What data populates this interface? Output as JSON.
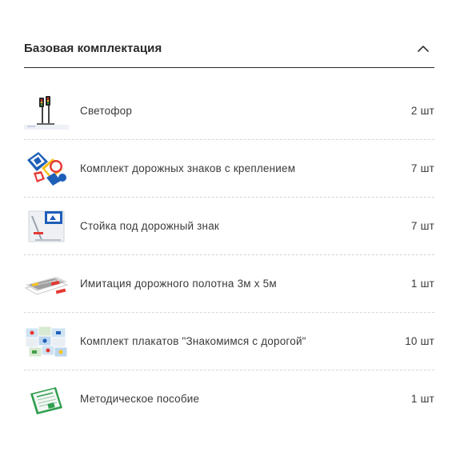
{
  "section": {
    "title": "Базовая комплектация",
    "expanded": true,
    "toggle_icon": "chevron-up-icon"
  },
  "items": [
    {
      "label": "Светофор",
      "qty": "2 шт",
      "icon": "traffic-light-image"
    },
    {
      "label": "Комплект дорожных знаков с креплением",
      "qty": "7 шт",
      "icon": "road-signs-image"
    },
    {
      "label": "Стойка под дорожный знак",
      "qty": "7 шт",
      "icon": "sign-stand-image"
    },
    {
      "label": "Имитация дорожного полотна 3м х 5м",
      "qty": "1 шт",
      "icon": "road-mat-image"
    },
    {
      "label": "Комплект плакатов \"Знакомимся с дорогой\"",
      "qty": "10 шт",
      "icon": "posters-image"
    },
    {
      "label": "Методическое пособие",
      "qty": "1 шт",
      "icon": "manual-image"
    }
  ]
}
